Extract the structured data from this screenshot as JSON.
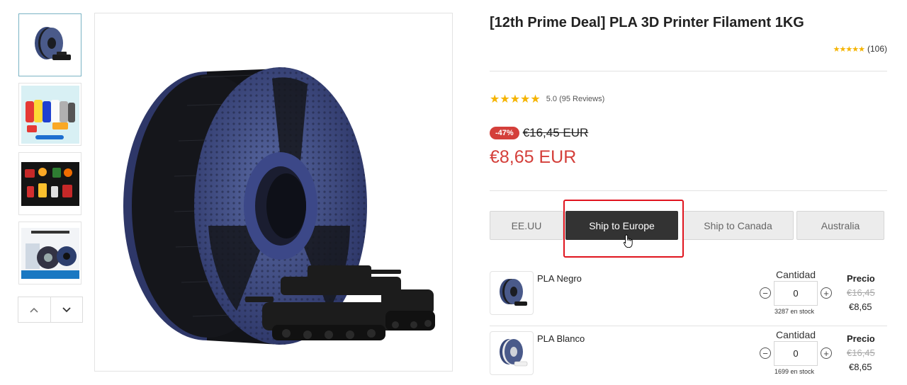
{
  "product": {
    "title": "[12th Prime Deal] PLA 3D Printer Filament 1KG",
    "top_rating": {
      "stars": 4.5,
      "count": "(106)"
    },
    "review_rating": {
      "stars": 5,
      "text": "5.0 (95 Reviews)"
    },
    "discount": "-47%",
    "old_price": "€16,45 EUR",
    "new_price": "€8,65 EUR"
  },
  "gallery": {
    "thumbnails": [
      {
        "name": "black-spool-thumb",
        "active": true
      },
      {
        "name": "colorful-spools-thumb",
        "active": false
      },
      {
        "name": "printed-models-thumb",
        "active": false
      },
      {
        "name": "packaging-thumb",
        "active": false
      }
    ],
    "nav": {
      "up_icon": "chevron-up-icon",
      "down_icon": "chevron-down-icon"
    }
  },
  "shipping": {
    "tabs": [
      {
        "label": "EE.UU",
        "active": false
      },
      {
        "label": "Ship to Europe",
        "active": true
      },
      {
        "label": "Ship to Canada",
        "active": false
      },
      {
        "label": "Australia",
        "active": false
      }
    ]
  },
  "variants": [
    {
      "name": "PLA Negro",
      "quantity_label": "Cantidad",
      "quantity": "0",
      "stock": "3287 en stock",
      "price_label": "Precio",
      "old_price": "€16,45",
      "new_price": "€8,65",
      "spool_color": "#2b2f3a"
    },
    {
      "name": "PLA Blanco",
      "quantity_label": "Cantidad",
      "quantity": "0",
      "stock": "1699 en stock",
      "price_label": "Precio",
      "old_price": "€16,45",
      "new_price": "€8,65",
      "spool_color": "#e8e8ea"
    }
  ],
  "colors": {
    "accent_red": "#d43f3a",
    "highlight_red": "#e0141e",
    "active_tab": "#333333",
    "star": "#f5b400"
  }
}
